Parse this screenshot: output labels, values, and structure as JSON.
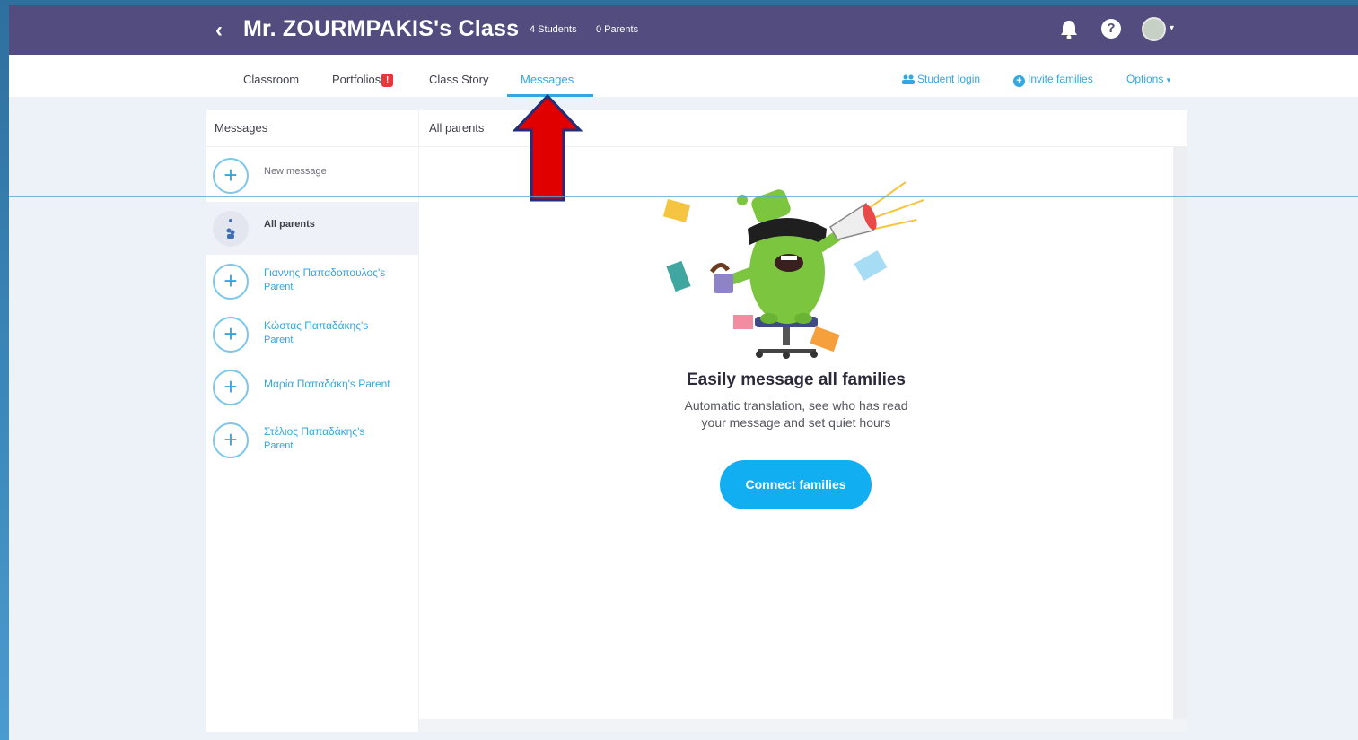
{
  "header": {
    "title": "Mr. ZOURMPAKIS's Class",
    "students": "4 Students",
    "parents": "0 Parents"
  },
  "tabs": {
    "classroom": "Classroom",
    "portfolios": "Portfolios",
    "portfolios_badge": "!",
    "class_story": "Class Story",
    "messages": "Messages"
  },
  "top_links": {
    "student_login": "Student login",
    "invite_families": "Invite families",
    "options": "Options"
  },
  "left_panel": {
    "title": "Messages",
    "new_message": "New message",
    "all_parents": "All parents",
    "contacts": [
      {
        "name": "Γιαννης Παπαδοπουλος's",
        "role": "Parent"
      },
      {
        "name": "Κώστας Παπαδάκης's",
        "role": "Parent"
      },
      {
        "name": "Μαρία Παπαδάκη's Parent",
        "role": ""
      },
      {
        "name": "Στέλιος Παπαδάκης's",
        "role": "Parent"
      }
    ]
  },
  "right_panel": {
    "title": "All parents",
    "empty_title": "Easily message all families",
    "empty_desc": "Automatic translation, see who has read your message and set quiet hours",
    "button": "Connect families"
  },
  "colors": {
    "header_bg": "#524d7e",
    "accent": "#33a7e0",
    "button": "#12aef2",
    "annotation_arrow": "#e00000"
  }
}
